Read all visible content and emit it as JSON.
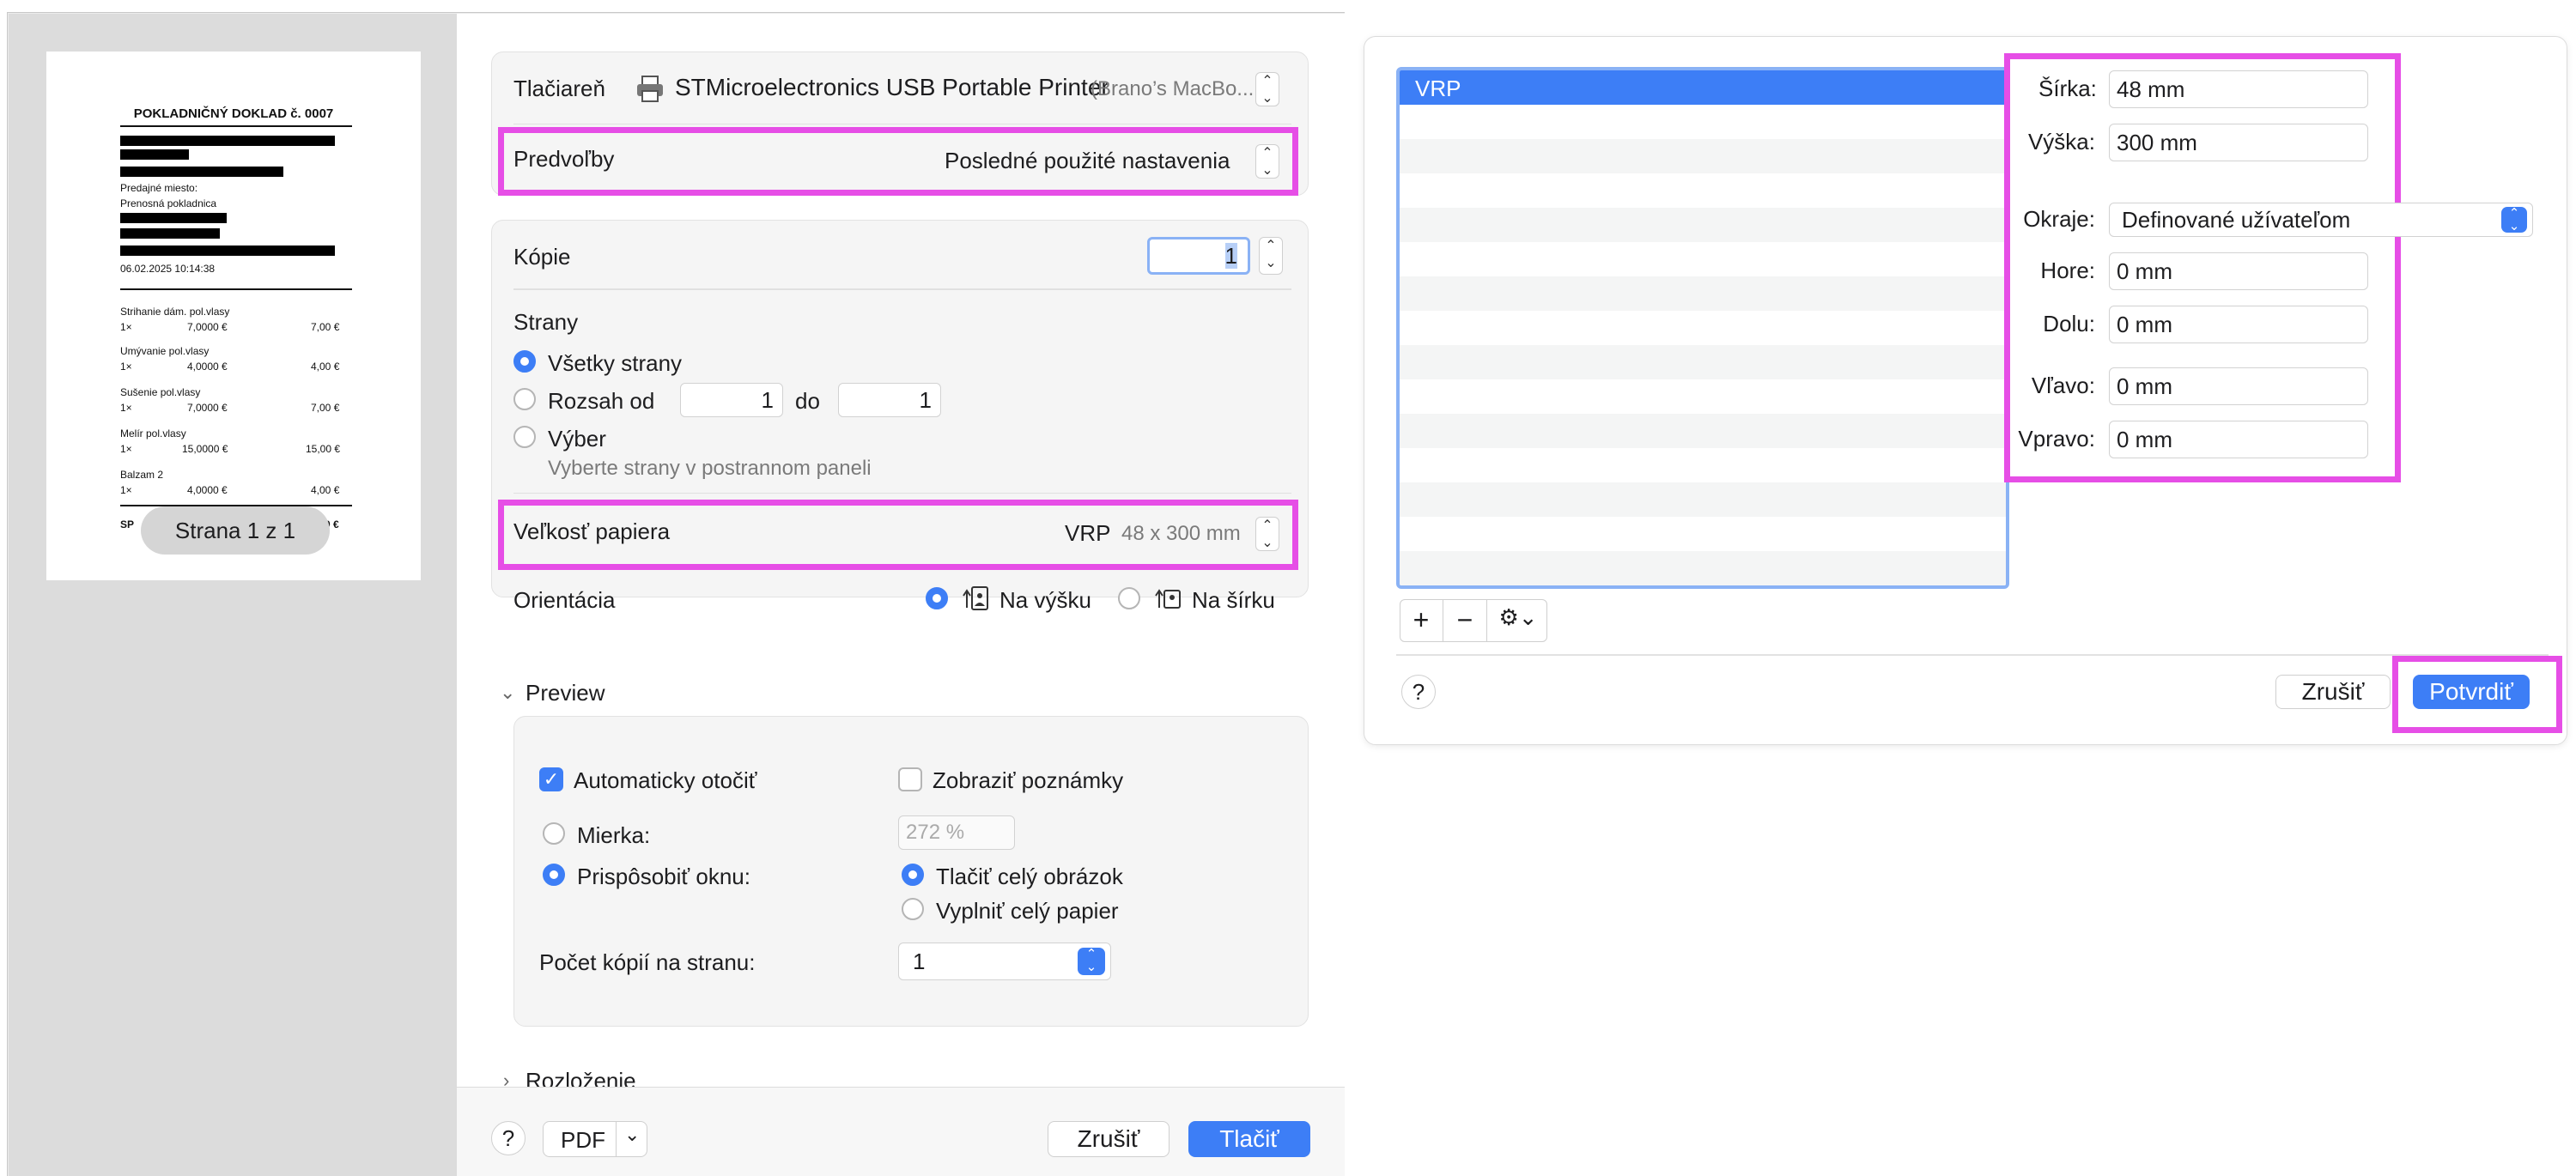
{
  "print_dialog": {
    "preview": {
      "receipt": {
        "title": "POKLADNIČNÝ DOKLAD č. 0007",
        "place_label": "Predajné miesto:",
        "place_value": "Prenosná pokladnica",
        "datetime": "06.02.2025 10:14:38",
        "items": [
          {
            "name": "Strihanie dám. pol.vlasy",
            "qty": "1×",
            "unit": "7,0000 €",
            "total": "7,00 €"
          },
          {
            "name": "Umývanie pol.vlasy",
            "qty": "1×",
            "unit": "4,0000 €",
            "total": "4,00 €"
          },
          {
            "name": "Sušenie pol.vlasy",
            "qty": "1×",
            "unit": "7,0000 €",
            "total": "7,00 €"
          },
          {
            "name": "Melír pol.vlasy",
            "qty": "1×",
            "unit": "15,0000 €",
            "total": "15,00 €"
          },
          {
            "name": "Balzam 2",
            "qty": "1×",
            "unit": "4,0000 €",
            "total": "4,00 €"
          }
        ],
        "footer_left": "SP",
        "footer_right": "0 €"
      },
      "page_badge": "Strana 1 z 1"
    },
    "printer": {
      "label": "Tlačiareň",
      "name": "STMicroelectronics USB Portable Printer",
      "host": "(Brano’s MacBo..."
    },
    "presets": {
      "label": "Predvoľby",
      "value": "Posledné použité nastavenia"
    },
    "copies": {
      "label": "Kópie",
      "value": "1"
    },
    "pages": {
      "label": "Strany",
      "all": "Všetky strany",
      "range_label": "Rozsah od",
      "range_from": "1",
      "range_to_label": "do",
      "range_to": "1",
      "selection": "Výber",
      "selection_hint": "Vyberte strany v postrannom paneli"
    },
    "paper_size": {
      "label": "Veľkosť papiera",
      "value": "VRP",
      "dims": "48 x 300 mm"
    },
    "orientation": {
      "label": "Orientácia",
      "portrait": "Na výšku",
      "landscape": "Na šírku"
    },
    "preview_section": {
      "title": "Preview",
      "auto_rotate": "Automaticky otočiť",
      "show_notes": "Zobraziť poznámky",
      "scale_label": "Mierka:",
      "scale_value": "272 %",
      "fit_label": "Prispôsobiť oknu:",
      "print_entire": "Tlačiť celý obrázok",
      "fill_paper": "Vyplniť celý papier",
      "copies_per_page_label": "Počet kópií na stranu:",
      "copies_per_page_value": "1"
    },
    "layout_section": {
      "title": "Rozloženie"
    },
    "footer": {
      "help": "?",
      "pdf": "PDF",
      "cancel": "Zrušiť",
      "print": "Tlačiť"
    }
  },
  "paper_dialog": {
    "list_items": [
      "VRP"
    ],
    "width": {
      "label": "Šírka:",
      "value": "48 mm"
    },
    "height": {
      "label": "Výška:",
      "value": "300 mm"
    },
    "margins": {
      "label": "Okraje:",
      "value": "Definované užívateľom"
    },
    "top": {
      "label": "Hore:",
      "value": "0 mm"
    },
    "bottom": {
      "label": "Dolu:",
      "value": "0 mm"
    },
    "left": {
      "label": "Vľavo:",
      "value": "0 mm"
    },
    "right": {
      "label": "Vpravo:",
      "value": "0 mm"
    },
    "toolbar": {
      "add": "+",
      "remove": "−"
    },
    "footer": {
      "help": "?",
      "cancel": "Zrušiť",
      "confirm": "Potvrdiť"
    }
  },
  "colors": {
    "accent": "#3d7ef6",
    "highlight": "#e64ee6"
  }
}
